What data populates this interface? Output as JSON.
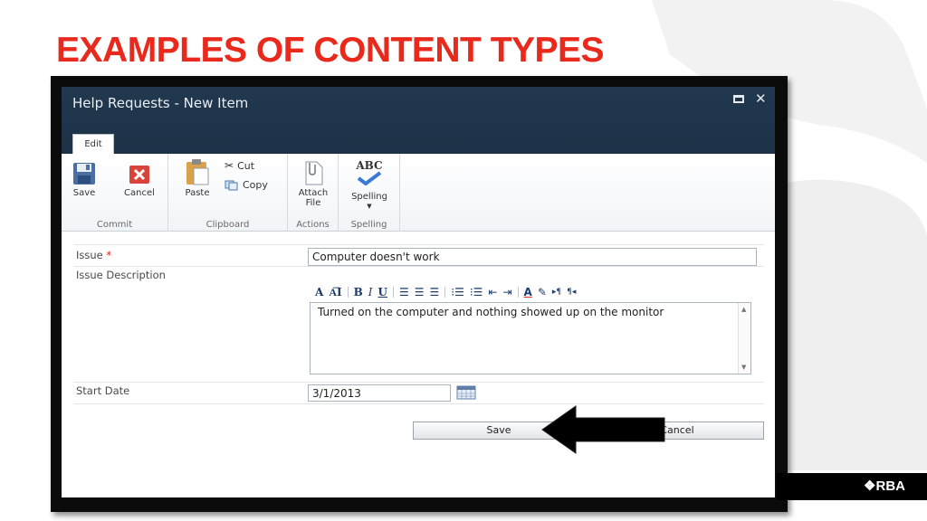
{
  "slide": {
    "title": "EXAMPLES OF CONTENT TYPES",
    "logo_text": "❖RBA",
    "accent_color": "#e8291c"
  },
  "window": {
    "title": "Help Requests - New Item",
    "active_tab": "Edit"
  },
  "ribbon": {
    "commit": {
      "save": "Save",
      "cancel": "Cancel",
      "label": "Commit"
    },
    "clipboard": {
      "paste": "Paste",
      "cut": "Cut",
      "copy": "Copy",
      "label": "Clipboard"
    },
    "actions": {
      "attach_line1": "Attach",
      "attach_line2": "File",
      "label": "Actions"
    },
    "spelling": {
      "button": "Spelling",
      "icon_text": "ABC",
      "label": "Spelling"
    }
  },
  "form": {
    "issue": {
      "label": "Issue",
      "required_mark": "*",
      "value": "Computer doesn't work"
    },
    "issue_description": {
      "label": "Issue Description",
      "value": "Turned on the computer and nothing showed up on the monitor"
    },
    "start_date": {
      "label": "Start Date",
      "value": "3/1/2013"
    },
    "save_button": "Save",
    "cancel_button": "Cancel"
  },
  "icons": [
    "save-icon",
    "cancel-icon",
    "paste-icon",
    "cut-icon",
    "copy-icon",
    "attach-file-icon",
    "spelling-icon",
    "calendar-icon",
    "close-icon",
    "maximize-icon",
    "arrow-pointer"
  ]
}
